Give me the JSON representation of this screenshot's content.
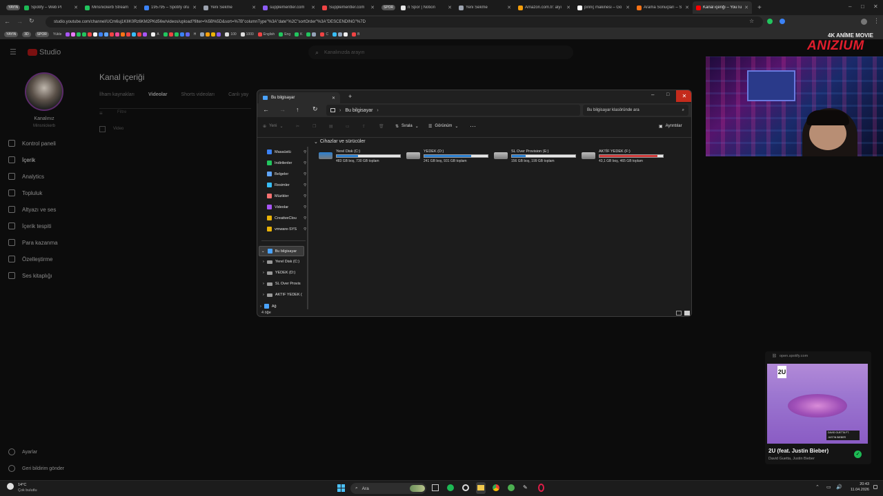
{
  "tabs": [
    {
      "label": "YAYIN",
      "kind": "pill"
    },
    {
      "label": "Spotify – Web Pl",
      "color": "#1db954"
    },
    {
      "label": "Minsnickerb Stream",
      "color": "#22c55e"
    },
    {
      "label": "195795 – Spotify ofu",
      "color": "#3b82f6"
    },
    {
      "label": "Yeni Sekme",
      "color": "#9ca3af"
    },
    {
      "label": "supplementler.com",
      "color": "#8b5cf6"
    },
    {
      "label": "Supplementler.com",
      "color": "#ef4444"
    },
    {
      "label": "SPOR",
      "kind": "pill"
    },
    {
      "label": "n Spor | Notion",
      "color": "#e5e5e5"
    },
    {
      "label": "Yeni Sekme",
      "color": "#9ca3af"
    },
    {
      "label": "Amazon.com.tr: alyı",
      "color": "#f59e0b"
    },
    {
      "label": "pirinç makinesi – Go",
      "color": "#ffffff"
    },
    {
      "label": "Arama Sonuçları – S",
      "color": "#f97316"
    },
    {
      "label": "Kanal içeriği – YouTu",
      "color": "#ff0000",
      "active": true
    }
  ],
  "address": {
    "url": "studio.youtube.com/channel/UCm6uj1KIIK0Rz6KM2PKd56w/videos/upload?filter=%5B%5D&sort=%7B\"columnType\"%3A\"date\"%2C\"sortOrder\"%3A\"DESCENDING\"%7D"
  },
  "bookmarks": {
    "pill_yayin": "YAYIN",
    "pill_3d": "3D",
    "pill_spor": "SPOR",
    "yukle": "Yükle",
    "n100": "100",
    "n1000": "1000",
    "english": "English",
    "eng": "Eng",
    "k": "K",
    "c": "C",
    "b": "B",
    "a": "A",
    "h": "H"
  },
  "studio": {
    "logo": "Studio",
    "search_placeholder": "Kanalınızda arayın",
    "page_title": "Kanal içeriği",
    "tabs": [
      "İlham kaynakları",
      "Videolar",
      "Shorts videoları",
      "Canlı yay"
    ],
    "filter_placeholder": "Filtre",
    "column_video": "Video",
    "channel_label": "Kanalınız",
    "channel_name": "Minsnickerb",
    "nav": [
      "Kontrol paneli",
      "İçerik",
      "Analytics",
      "Topluluk",
      "Altyazı ve ses",
      "İçerik tespiti",
      "Para kazanma",
      "Özelleştirme",
      "Ses kitaplığı"
    ],
    "nav_bottom": [
      "Ayarlar",
      "Geri bildirim gönder"
    ]
  },
  "explorer": {
    "tab_title": "Bu bilgisayar",
    "breadcrumb": "Bu bilgisayar",
    "search_placeholder": "Bu bilgisayar klasöründe ara",
    "cmd_new": "Yeni",
    "cmd_sort": "Sırala",
    "cmd_view": "Görünüm",
    "cmd_details": "Ayrıntılar",
    "section_header": "Cihazlar ve sürücüler",
    "quick_access": [
      {
        "label": "Masaüstü",
        "color": "#3b82f6"
      },
      {
        "label": "İndirilenler",
        "color": "#22c55e"
      },
      {
        "label": "Belgeler",
        "color": "#60a5fa"
      },
      {
        "label": "Resimler",
        "color": "#38bdf8"
      },
      {
        "label": "Müzikler",
        "color": "#f87171"
      },
      {
        "label": "Videolar",
        "color": "#a855f7"
      },
      {
        "label": "CreativeClou",
        "color": "#eab308"
      },
      {
        "label": "vmware-SYS",
        "color": "#eab308"
      }
    ],
    "tree_root": "Bu bilgisayar",
    "tree_children": [
      "Yerel Disk (C:)",
      "YEDEK (D:)",
      "SL Over Provis",
      "AKTİF YEDEK ("
    ],
    "tree_network": "Ağ",
    "status": "4 öğe",
    "drives": [
      {
        "name": "Yerel Disk (C:)",
        "size": "483 GB boş, 730 GB toplam",
        "used_fraction": 0.34,
        "color": "#2a7fd0"
      },
      {
        "name": "YEDEK (D:)",
        "size": "241 GB boş, 931 GB toplam",
        "used_fraction": 0.74,
        "color": "#2a7fd0"
      },
      {
        "name": "SL Over Provision (E:)",
        "size": "156 GB boş, 199 GB toplam",
        "used_fraction": 0.22,
        "color": "#2a7fd0"
      },
      {
        "name": "AKTİF YEDEK (F:)",
        "size": "43,1 GB boş, 465 GB toplam",
        "used_fraction": 0.91,
        "color": "#d03a3a"
      }
    ]
  },
  "overlay": {
    "brand_top": "4K ANİME MOVIE",
    "brand_name": "ANIZIUM"
  },
  "spotify": {
    "source": "open.spotify.com",
    "cover_text": "2U",
    "cover_small": "DAVID GUETTA FT. JUSTIN BIEBER",
    "song": "2U (feat. Justin Bieber)",
    "artist": "David Guetta, Justin Bieber"
  },
  "taskbar": {
    "weather_temp": "14°C",
    "weather_desc": "Çok bulutlu",
    "search": "Ara",
    "time": "20:43",
    "date": "11.04.2026"
  }
}
